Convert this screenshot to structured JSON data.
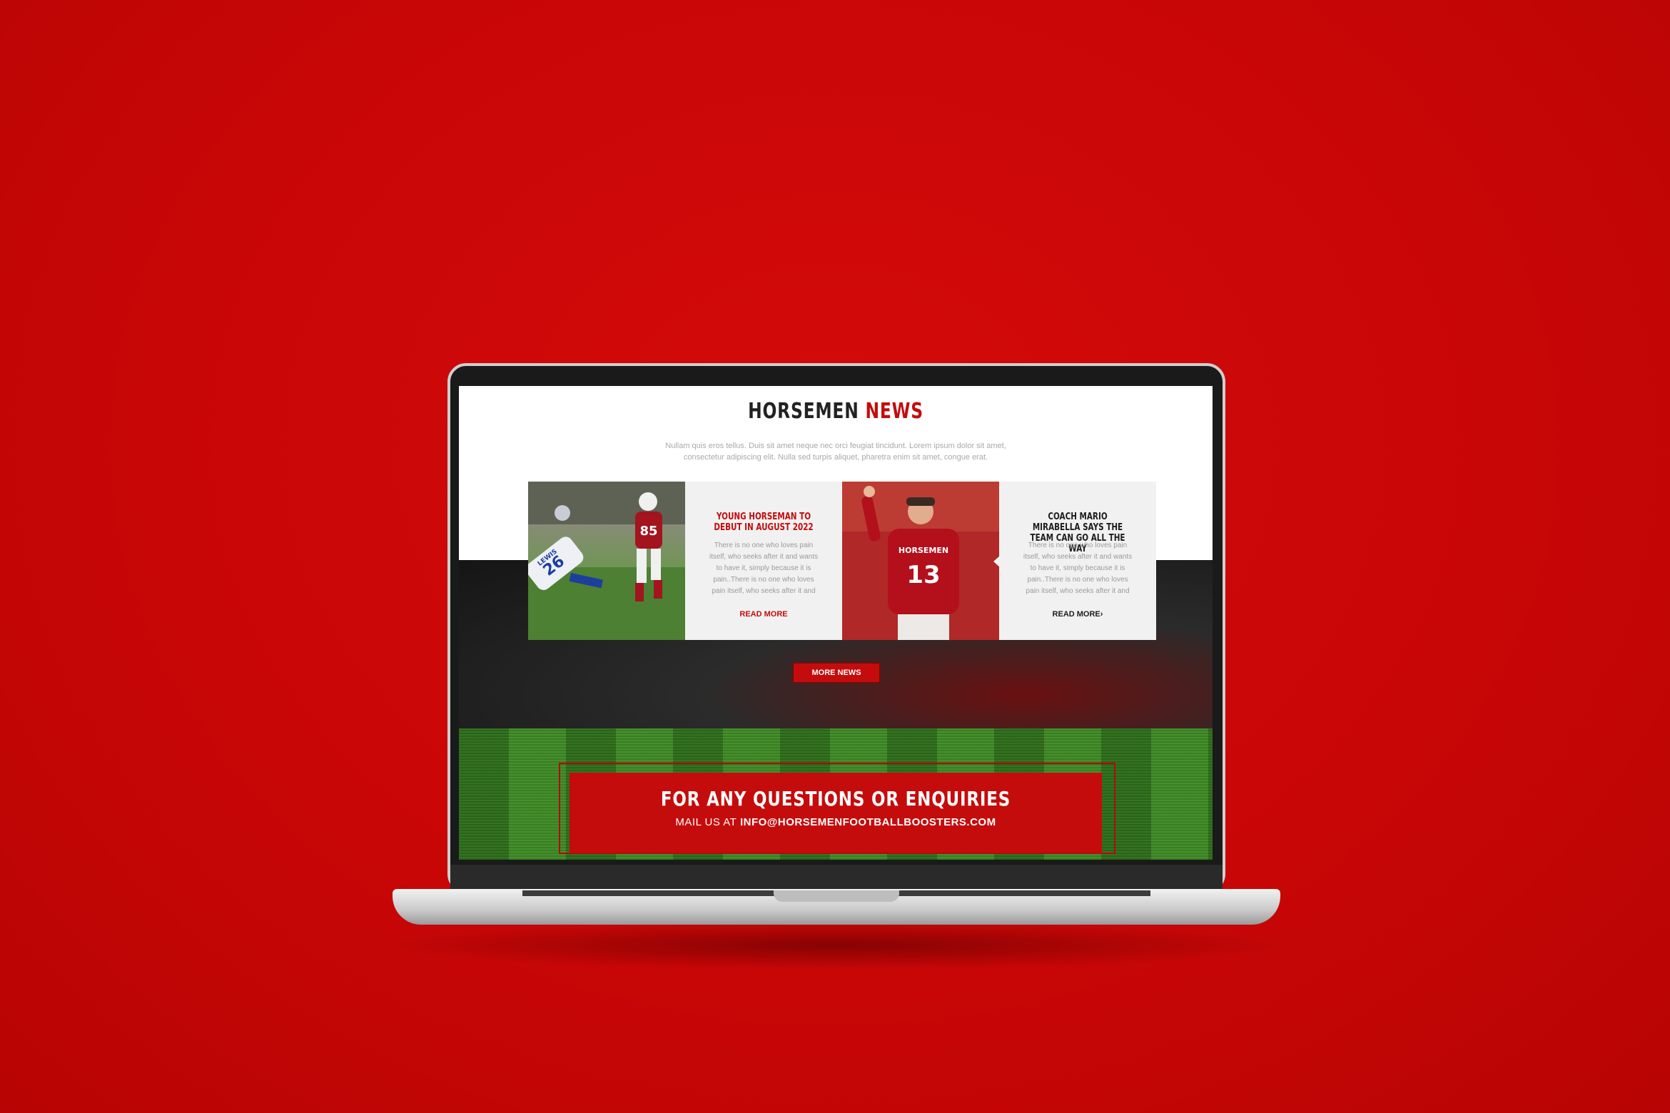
{
  "news": {
    "title_part1": "HORSEMEN",
    "title_part2": "NEWS",
    "intro_line1": "Nullam quis eros tellus. Duis sit amet neque nec orci feugiat tincidunt. Lorem ipsum dolor sit amet,",
    "intro_line2": "consectetur adipiscing elit. Nulla sed turpis aliquet, pharetra enim sit amet, congue erat.",
    "cards": [
      {
        "title": "YOUNG HORSEMAN TO DEBUT IN AUGUST 2022",
        "excerpt": "There is no one who loves pain itself, who seeks after it and wants to have it, simply because it is pain..There is no one who loves pain itself, who seeks after it and",
        "read_more": "READ MORE",
        "photo": {
          "jersey_red": "85",
          "jersey_white": "26",
          "name_white": "LEWIS"
        }
      },
      {
        "title": "COACH MARIO MIRABELLA SAYS THE TEAM CAN GO ALL THE WAY",
        "excerpt": "There is no one who loves pain itself, who seeks after it and wants to have it, simply because it is pain..There is no one who loves pain itself, who seeks after it and",
        "read_more": "READ MORE›",
        "photo": {
          "jersey_text": "HORSEMEN",
          "jersey_number": "13"
        }
      }
    ],
    "more_news": "MORE NEWS"
  },
  "enquiries": {
    "heading": "FOR ANY QUESTIONS OR ENQUIRIES",
    "mail_label": "MAIL US AT",
    "email": "INFO@HORSEMENFOOTBALLBOOSTERS.COM"
  },
  "colors": {
    "background": "#c90606",
    "brand_red": "#c40c0c",
    "dark_text": "#222222",
    "grass_dark": "#2d6d1a",
    "grass_light": "#3f8a25"
  }
}
